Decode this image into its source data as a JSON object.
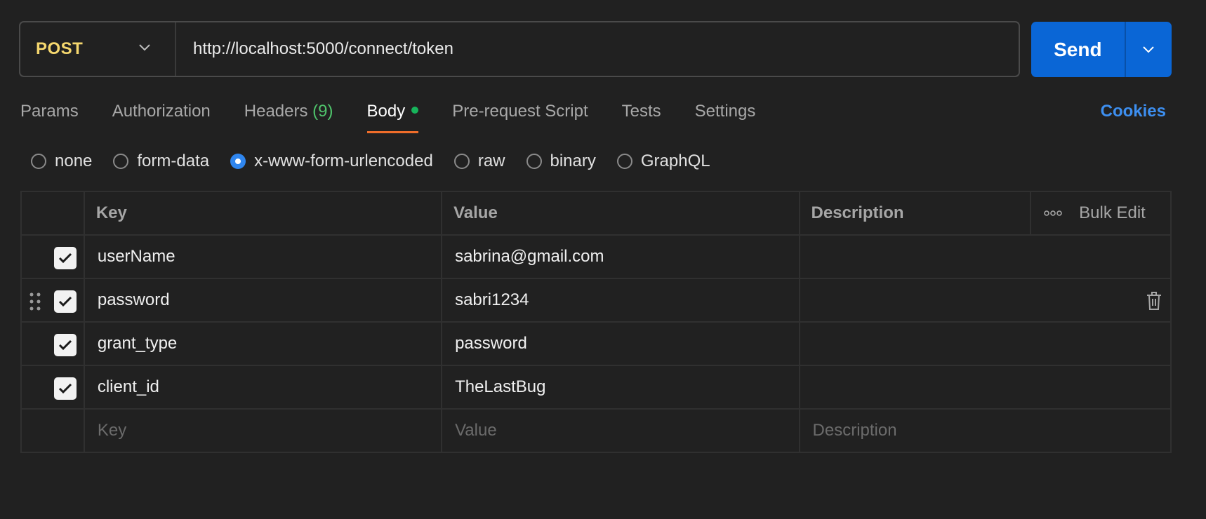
{
  "request": {
    "method": "POST",
    "url": "http://localhost:5000/connect/token",
    "send_label": "Send"
  },
  "tabs": [
    {
      "label": "Params"
    },
    {
      "label": "Authorization"
    },
    {
      "label": "Headers",
      "count": "(9)"
    },
    {
      "label": "Body",
      "active": true
    },
    {
      "label": "Pre-request Script"
    },
    {
      "label": "Tests"
    },
    {
      "label": "Settings"
    }
  ],
  "cookies_label": "Cookies",
  "body_types": [
    {
      "label": "none",
      "checked": false
    },
    {
      "label": "form-data",
      "checked": false
    },
    {
      "label": "x-www-form-urlencoded",
      "checked": true
    },
    {
      "label": "raw",
      "checked": false
    },
    {
      "label": "binary",
      "checked": false
    },
    {
      "label": "GraphQL",
      "checked": false
    }
  ],
  "table": {
    "headers": {
      "key": "Key",
      "value": "Value",
      "description": "Description",
      "bulk_edit": "Bulk Edit"
    },
    "rows": [
      {
        "key": "userName",
        "value": "sabrina@gmail.com",
        "description": "",
        "checked": true
      },
      {
        "key": "password",
        "value": "sabri1234",
        "description": "",
        "checked": true
      },
      {
        "key": "grant_type",
        "value": "password",
        "description": "",
        "checked": true
      },
      {
        "key": "client_id",
        "value": "TheLastBug",
        "description": "",
        "checked": true
      }
    ],
    "placeholders": {
      "key": "Key",
      "value": "Value",
      "description": "Description"
    }
  },
  "colors": {
    "background": "#212121",
    "method": "#f5d76e",
    "send": "#0a66d6",
    "tab_active_underline": "#f06d2a",
    "body_dot": "#17b45b",
    "headers_count": "#4fc36b",
    "cookies": "#3d8ff0",
    "radio_checked": "#2f86ef"
  }
}
